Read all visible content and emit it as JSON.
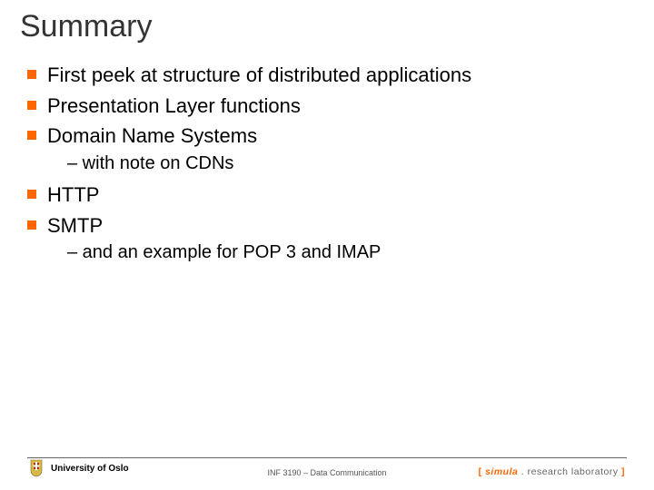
{
  "title": "Summary",
  "bullets": {
    "b0": "First peek at structure of distributed applications",
    "b1": "Presentation Layer functions",
    "b2": "Domain Name Systems",
    "s2": "– with note on CDNs",
    "b3": "HTTP",
    "b4": "SMTP",
    "s4": "– and an example for POP 3 and IMAP"
  },
  "footer": {
    "left": "University of Oslo",
    "center": "INF 3190 – Data Communication",
    "right_bracket_open": "[ ",
    "right_brand1": "simula",
    "right_dot": " . ",
    "right_brand2": "research laboratory",
    "right_bracket_close": " ]"
  }
}
